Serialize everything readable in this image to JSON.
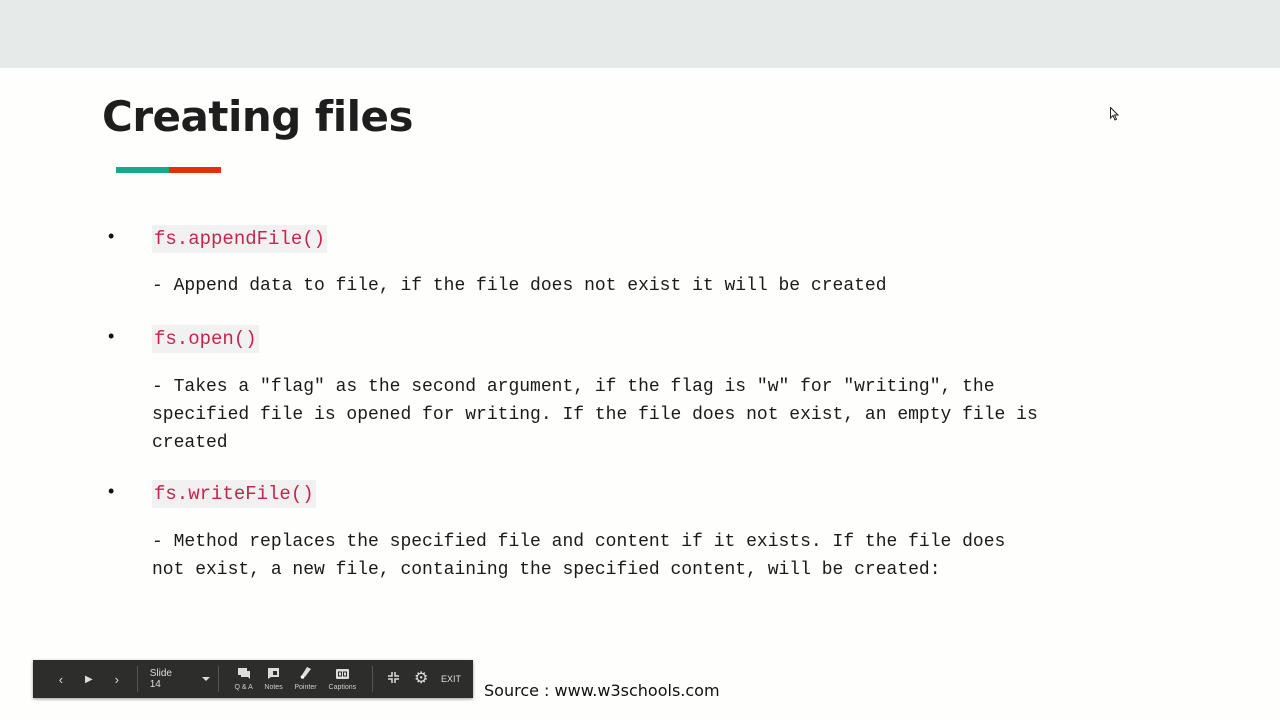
{
  "slide": {
    "title": "Creating files",
    "accent_colors": {
      "green": "#17a98a",
      "red": "#e2300d"
    },
    "items": [
      {
        "bullet": "•",
        "code": "fs.appendFile()",
        "description": "- Append data to file, if the file does not exist it will be created"
      },
      {
        "bullet": "•",
        "code": "fs.open()",
        "description": "- Takes a \"flag\" as the second argument, if the flag is \"w\" for \"writing\", the\nspecified file is opened for writing. If the file does not exist, an empty file is\ncreated"
      },
      {
        "bullet": "•",
        "code": "fs.writeFile()",
        "description": "- Method replaces the specified file and content if it exists. If the file does\nnot exist, a new file, containing the specified content, will be created:"
      }
    ],
    "source": "Source : www.w3schools.com"
  },
  "toolbar": {
    "prev_icon": "‹",
    "play_icon": "▶",
    "next_icon": "›",
    "slide_selector": "Slide 14",
    "qa_label": "Q & A",
    "notes_label": "Notes",
    "pointer_label": "Pointer",
    "captions_label": "Captions",
    "exit_label": "EXIT"
  }
}
